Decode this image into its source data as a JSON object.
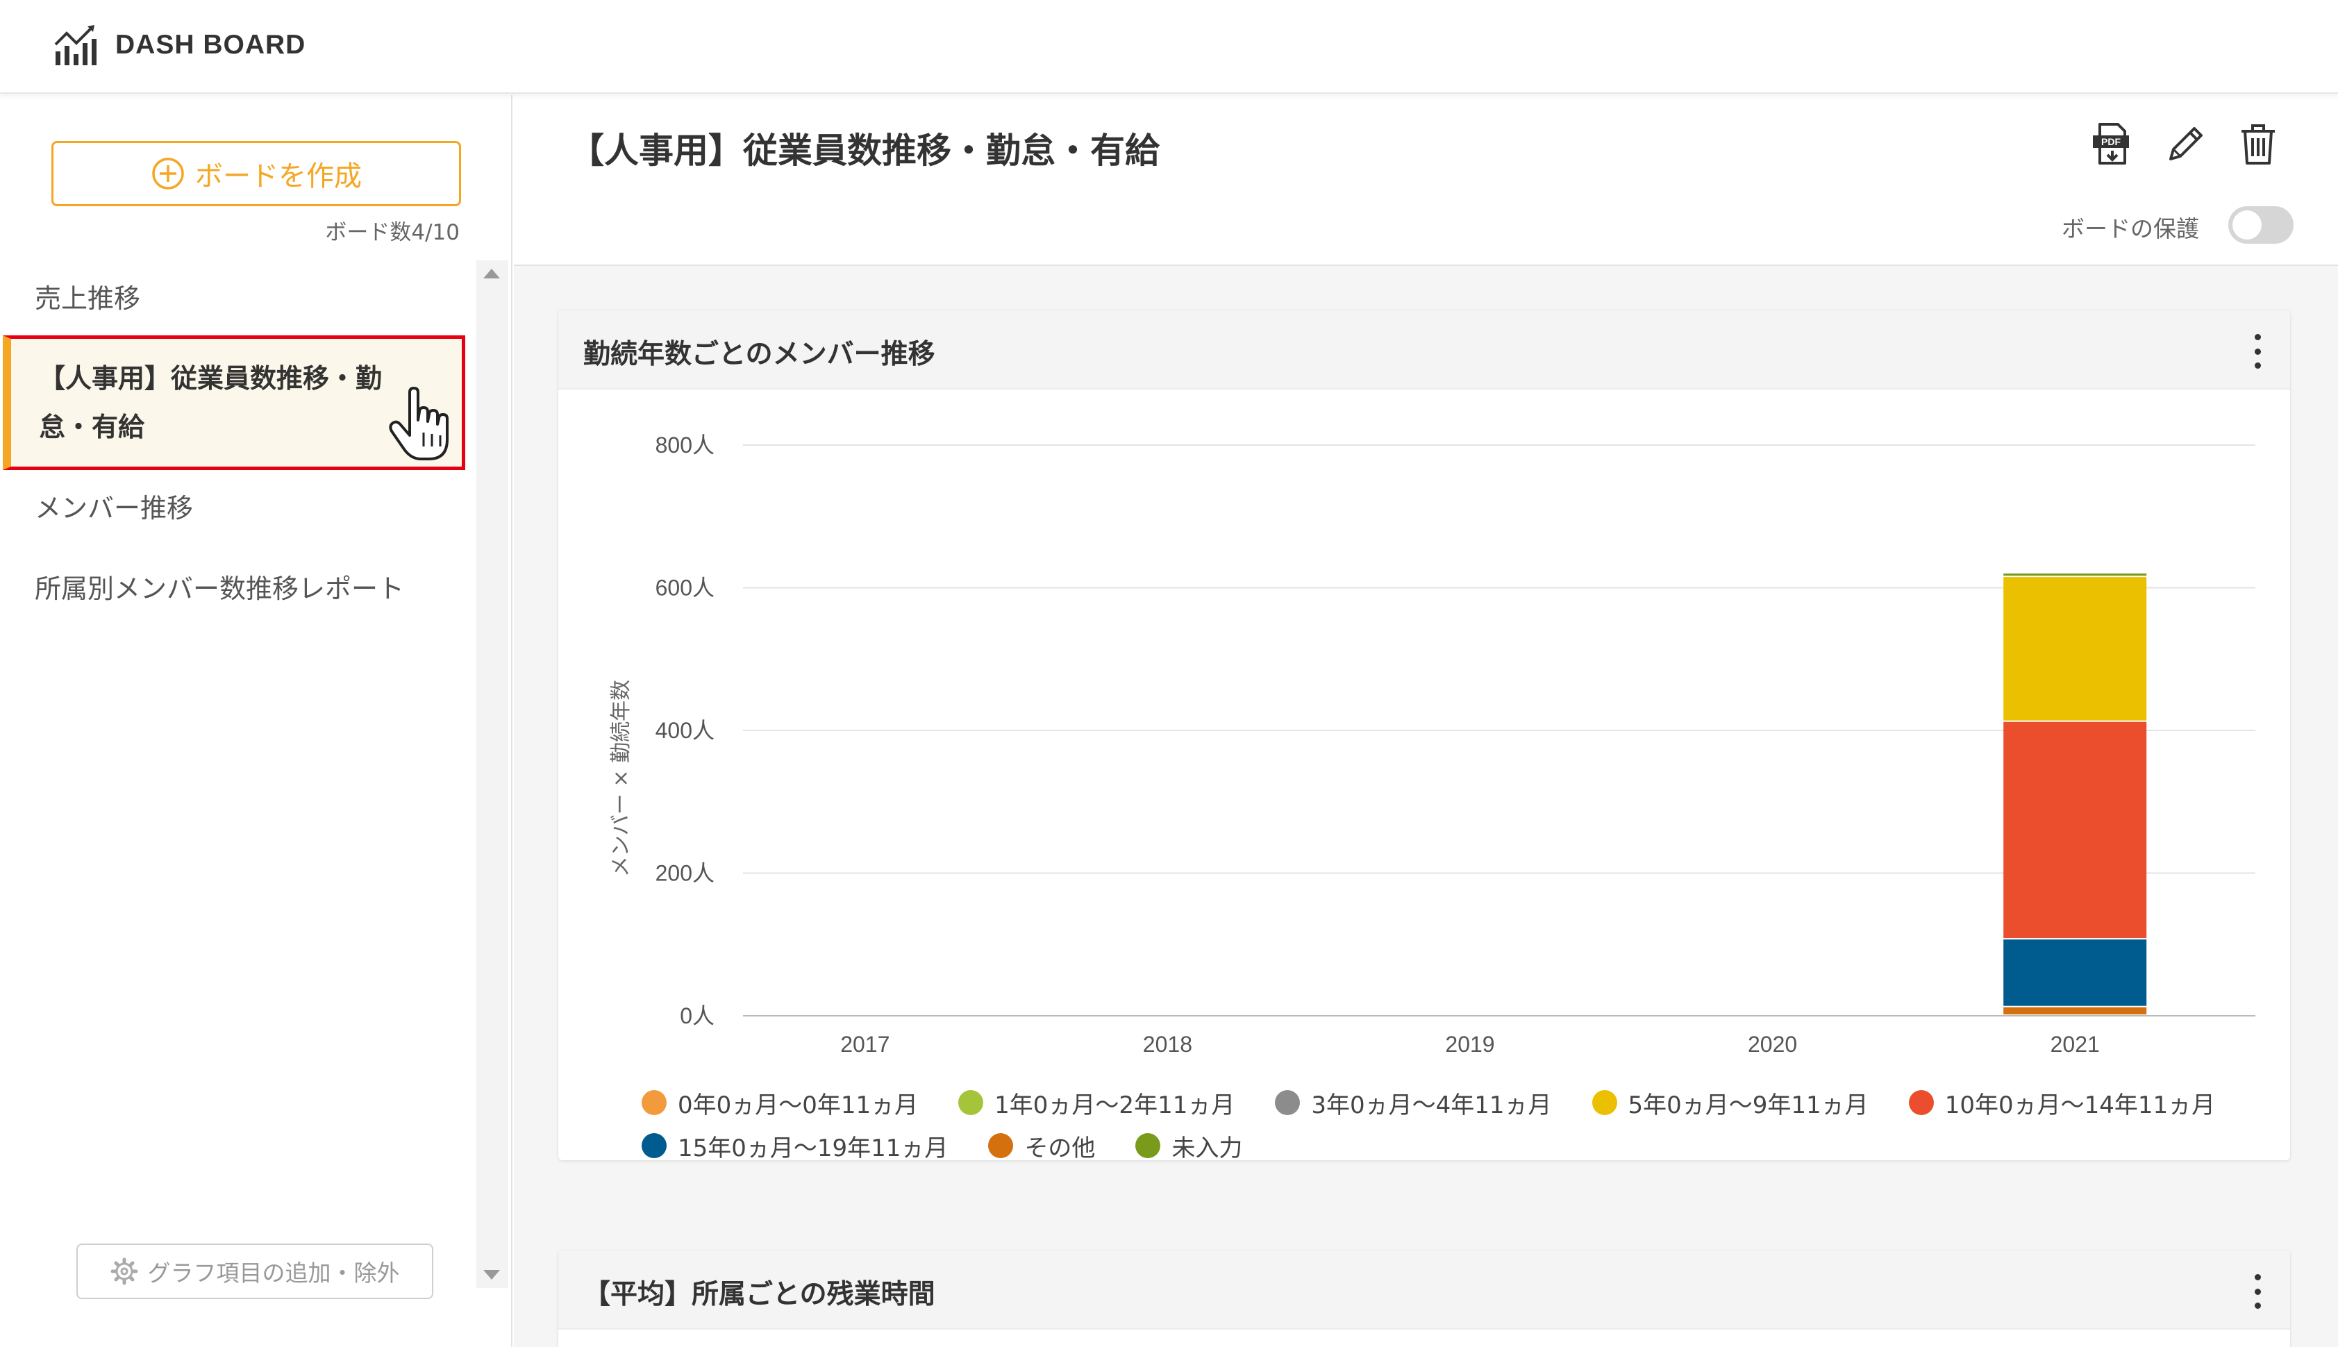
{
  "header": {
    "brand": "DASH BOARD"
  },
  "sidebar": {
    "create_button": "ボードを作成",
    "board_count": "ボード数4/10",
    "items": [
      {
        "label": "売上推移"
      },
      {
        "label": "【人事用】従業員数推移・勤怠・有給"
      },
      {
        "label": "メンバー推移"
      },
      {
        "label": "所属別メンバー数推移レポート"
      }
    ],
    "graph_items_button": "グラフ項目の追加・除外"
  },
  "main": {
    "title": "【人事用】従業員数推移・勤怠・有給",
    "protect_label": "ボードの保護",
    "protect_on": false,
    "cards": [
      {
        "title": "勤続年数ごとのメンバー推移"
      },
      {
        "title": "【平均】所属ごとの残業時間"
      }
    ]
  },
  "icons": {
    "brand": "chart-icon",
    "pdf": "pdf-download-icon",
    "edit": "pencil-icon",
    "delete": "trash-icon",
    "gear": "gear-icon",
    "add": "plus-circle-icon",
    "cursor": "hand-pointer-icon"
  },
  "colors": {
    "accent": "#f5a623",
    "highlight_border": "#e60012"
  },
  "chart_data": {
    "type": "bar",
    "stacked": true,
    "categories": [
      "2017",
      "2018",
      "2019",
      "2020",
      "2021"
    ],
    "ylabel": "メンバー × 勤続年数",
    "ylim": [
      0,
      800
    ],
    "yticks": [
      "0人",
      "200人",
      "400人",
      "600人",
      "800人"
    ],
    "ytick_values": [
      0,
      200,
      400,
      600,
      800
    ],
    "grid": true,
    "legend_position": "bottom",
    "series": [
      {
        "name": "0年0ヵ月～0年11ヵ月",
        "color": "#f39a3d",
        "values": [
          0,
          0,
          0,
          0,
          0
        ]
      },
      {
        "name": "1年0ヵ月～2年11ヵ月",
        "color": "#a5c43a",
        "values": [
          0,
          0,
          0,
          0,
          0
        ]
      },
      {
        "name": "3年0ヵ月～4年11ヵ月",
        "color": "#8c8c8c",
        "values": [
          0,
          0,
          0,
          0,
          0
        ]
      },
      {
        "name": "5年0ヵ月～9年11ヵ月",
        "color": "#ebc000",
        "values": [
          0,
          0,
          0,
          0,
          203
        ]
      },
      {
        "name": "10年0ヵ月～14年11ヵ月",
        "color": "#ea4e2c",
        "values": [
          0,
          0,
          0,
          0,
          305
        ]
      },
      {
        "name": "15年0ヵ月～19年11ヵ月",
        "color": "#005b8f",
        "values": [
          0,
          0,
          0,
          0,
          95
        ]
      },
      {
        "name": "その他",
        "color": "#d5700e",
        "values": [
          0,
          0,
          0,
          0,
          12
        ]
      },
      {
        "name": "未入力",
        "color": "#7a9a1c",
        "values": [
          0,
          0,
          0,
          0,
          5
        ]
      }
    ]
  }
}
